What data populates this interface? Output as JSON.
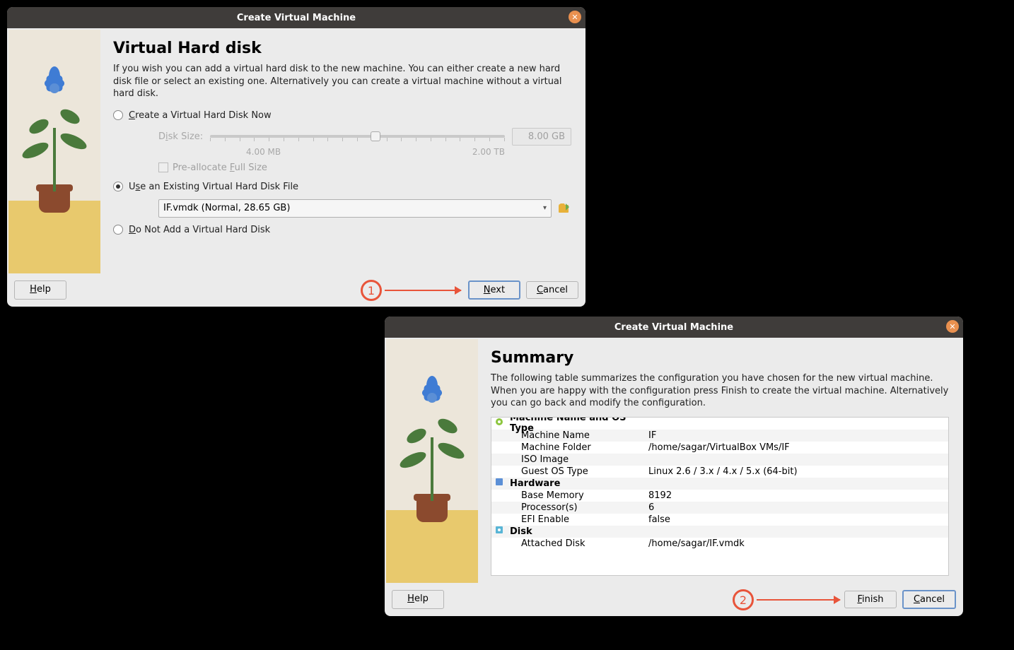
{
  "window1": {
    "title": "Create Virtual Machine",
    "heading": "Virtual Hard disk",
    "description": "If you wish you can add a virtual hard disk to the new machine. You can either create a new hard disk file or select an existing one. Alternatively you can create a virtual machine without a virtual hard disk.",
    "radio_create": "Create a Virtual Hard Disk Now",
    "disk_size_label": "Disk Size:",
    "disk_size_value": "8.00 GB",
    "slider_min": "4.00 MB",
    "slider_max": "2.00 TB",
    "preallocate": "Pre-allocate Full Size",
    "radio_existing": "Use an Existing Virtual Hard Disk File",
    "existing_file": "IF.vmdk (Normal, 28.65 GB)",
    "radio_none": "Do Not Add a Virtual Hard Disk",
    "help": "Help",
    "next": "Next",
    "cancel": "Cancel"
  },
  "window2": {
    "title": "Create Virtual Machine",
    "heading": "Summary",
    "description": "The following table summarizes the configuration you have chosen for the new virtual machine. When you are happy with the configuration press Finish to create the virtual machine. Alternatively you can go back and modify the configuration.",
    "sections": {
      "name_os": "Machine Name and OS Type",
      "hardware": "Hardware",
      "disk": "Disk"
    },
    "rows": {
      "machine_name_k": "Machine Name",
      "machine_name_v": "IF",
      "machine_folder_k": "Machine Folder",
      "machine_folder_v": "/home/sagar/VirtualBox VMs/IF",
      "iso_image_k": "ISO Image",
      "iso_image_v": "",
      "guest_os_k": "Guest OS Type",
      "guest_os_v": "Linux 2.6 / 3.x / 4.x / 5.x (64-bit)",
      "base_mem_k": "Base Memory",
      "base_mem_v": "8192",
      "proc_k": "Processor(s)",
      "proc_v": "6",
      "efi_k": "EFI Enable",
      "efi_v": "false",
      "att_disk_k": "Attached Disk",
      "att_disk_v": "/home/sagar/IF.vmdk"
    },
    "help": "Help",
    "finish": "Finish",
    "cancel": "Cancel"
  },
  "annotations": {
    "one": "1",
    "two": "2"
  }
}
